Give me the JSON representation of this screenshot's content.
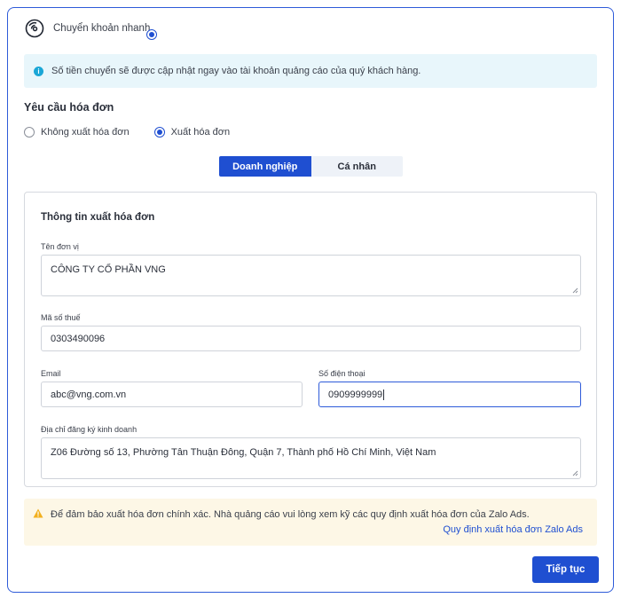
{
  "header": {
    "title": "Chuyển khoản nhanh",
    "icon": "transfer-icon",
    "selected": true
  },
  "info": {
    "text": "Số tiền chuyển sẽ được cập nhật ngay vào tài khoản quảng cáo của quý khách hàng."
  },
  "invoice": {
    "title": "Yêu cầu hóa đơn",
    "options": [
      {
        "label": "Không xuất hóa đơn",
        "selected": false
      },
      {
        "label": "Xuất hóa đơn",
        "selected": true
      }
    ],
    "tabs": [
      {
        "label": "Doanh nghiệp",
        "active": true
      },
      {
        "label": "Cá nhân",
        "active": false
      }
    ]
  },
  "form": {
    "title": "Thông tin xuất hóa đơn",
    "company_label": "Tên đơn vị",
    "company_value": "CÔNG TY CỔ PHẦN VNG",
    "tax_label": "Mã số thuế",
    "tax_value": "0303490096",
    "email_label": "Email",
    "email_value": "abc@vng.com.vn",
    "phone_label": "Số điện thoại",
    "phone_value": "0909999999",
    "address_label": "Địa chỉ đăng ký kinh doanh",
    "address_value": "Z06 Đường số 13, Phường Tân Thuận Đông, Quận 7, Thành phố Hồ Chí Minh, Việt Nam"
  },
  "warning": {
    "text": "Để đảm bảo xuất hóa đơn chính xác. Nhà quảng cáo vui lòng xem kỹ các quy định xuất hóa đơn của Zalo Ads.",
    "link": "Quy định xuất hóa đơn Zalo Ads"
  },
  "actions": {
    "next_label": "Tiếp tục"
  },
  "colors": {
    "primary": "#1f4fd1",
    "info_bg": "#e8f6fb",
    "warning_bg": "#fdf7e6",
    "warning_icon": "#f2b01e"
  }
}
